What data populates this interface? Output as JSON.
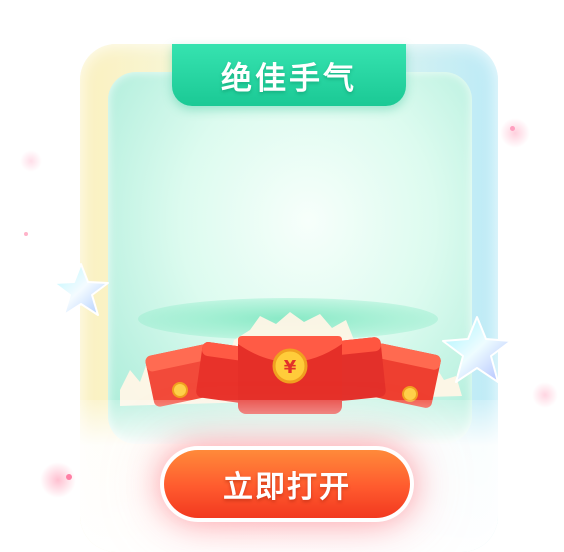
{
  "dialog": {
    "title": "绝佳手气",
    "open_button_label": "立即打开"
  },
  "icons": {
    "left_star": "star-icon",
    "right_star": "star-icon",
    "envelopes": "red-envelope-icon",
    "coin": "yuan-coin-icon"
  },
  "colors": {
    "title_tab": "#1bc995",
    "button": "#ff5a2e",
    "envelope": "#e8322a"
  }
}
